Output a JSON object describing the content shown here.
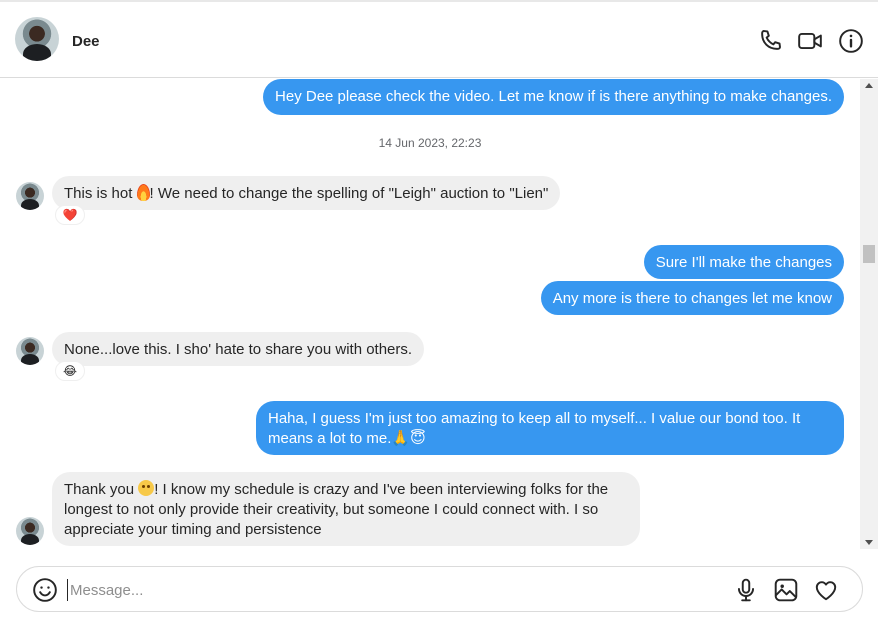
{
  "header": {
    "contact_name": "Dee",
    "icons": [
      "phone-icon",
      "video-call-icon",
      "info-icon"
    ]
  },
  "thread": {
    "timestamp": "14 Jun 2023, 22:23",
    "messages": [
      {
        "dir": "out",
        "text": "Hey Dee please check the video. Let me know if is there anything to make changes."
      },
      {
        "dir": "in",
        "text_before": "This is hot ",
        "emoji": "fire-emoji",
        "text_after": "! We need to change the spelling of \"Leigh\" auction to \"Lien\"",
        "reaction": "❤️"
      },
      {
        "dir": "out",
        "text": "Sure I'll make the changes"
      },
      {
        "dir": "out",
        "text": "Any more is there to changes let me know"
      },
      {
        "dir": "in",
        "text": "None...love this. I sho' hate to share you with others.",
        "reaction": "😂"
      },
      {
        "dir": "out",
        "text": "Haha, I guess I'm just too amazing to keep all to myself... I value our bond too. It means a lot to me.🙏😇"
      },
      {
        "dir": "in",
        "text_before": "Thank you ",
        "emoji": "smile-emoji",
        "text_after": "! I know my schedule is crazy and I've been interviewing folks for the longest to not only provide their creativity, but someone I could connect with. I so appreciate your timing and persistence"
      }
    ]
  },
  "composer": {
    "placeholder": "Message...",
    "icons": [
      "emoji-icon",
      "microphone-icon",
      "image-icon",
      "heart-icon"
    ]
  },
  "colors": {
    "outgoing_bubble": "#3797f0",
    "incoming_bubble": "#efefef"
  }
}
